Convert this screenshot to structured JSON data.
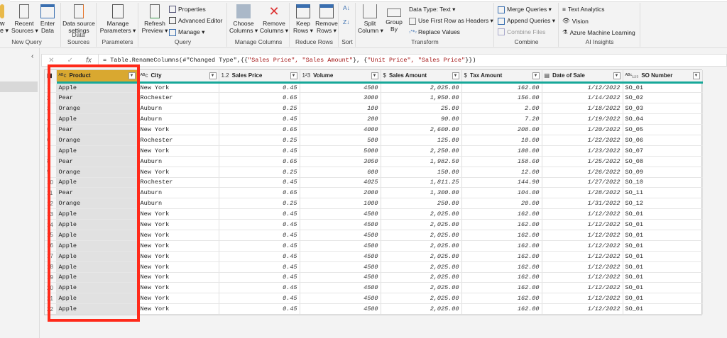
{
  "ribbon": {
    "groups": {
      "new_query": {
        "label": "New Query",
        "new_source": "w\ne ▾",
        "recent_sources": "Recent\nSources ▾",
        "enter_data": "Enter\nData"
      },
      "data_sources": {
        "label": "Data Sources",
        "settings": "Data source\nsettings"
      },
      "parameters": {
        "label": "Parameters",
        "manage": "Manage\nParameters ▾"
      },
      "query": {
        "label": "Query",
        "refresh": "Refresh\nPreview ▾",
        "properties": "Properties",
        "advanced_editor": "Advanced Editor",
        "manage": "Manage ▾"
      },
      "manage_columns": {
        "label": "Manage Columns",
        "choose": "Choose\nColumns ▾",
        "remove": "Remove\nColumns ▾"
      },
      "reduce_rows": {
        "label": "Reduce Rows",
        "keep": "Keep\nRows ▾",
        "remove": "Remove\nRows ▾"
      },
      "sort": {
        "label": "Sort"
      },
      "transform": {
        "label": "Transform",
        "split": "Split\nColumn ▾",
        "group_by": "Group\nBy",
        "data_type": "Data Type: Text ▾",
        "first_row": "Use First Row as Headers ▾",
        "replace": "Replace Values"
      },
      "combine": {
        "label": "Combine",
        "merge": "Merge Queries ▾",
        "append": "Append Queries ▾",
        "combine_files": "Combine Files"
      },
      "ai": {
        "label": "AI Insights",
        "text_analytics": "Text Analytics",
        "vision": "Vision",
        "azure_ml": "Azure Machine Learning"
      }
    }
  },
  "formula": {
    "fx": "fx",
    "prefix": "= Table.RenameColumns(#\"Changed Type\",{{",
    "s1": "\"Sales Price\", \"Sales Amount\"",
    "mid": "}, {",
    "s2": "\"Unit Price\", \"Sales Price\"",
    "suffix": "}})"
  },
  "table": {
    "columns": [
      {
        "name": "Product",
        "type_icon": "ABC",
        "selected": true
      },
      {
        "name": "City",
        "type_icon": "ABC"
      },
      {
        "name": "Sales Price",
        "type_icon": "1.2"
      },
      {
        "name": "Volume",
        "type_icon": "123"
      },
      {
        "name": "Sales Amount",
        "type_icon": "$"
      },
      {
        "name": "Tax Amount",
        "type_icon": "$"
      },
      {
        "name": "Date of Sale",
        "type_icon": "calendar"
      },
      {
        "name": "SO Number",
        "type_icon": "ABC123"
      }
    ],
    "rows": [
      [
        "Apple",
        "New York",
        "0.45",
        "4500",
        "2,025.00",
        "162.00",
        "1/12/2022",
        "SO_01"
      ],
      [
        "Pear",
        "Rochester",
        "0.65",
        "3000",
        "1,950.00",
        "156.00",
        "1/14/2022",
        "SO_02"
      ],
      [
        "Orange",
        "Auburn",
        "0.25",
        "100",
        "25.00",
        "2.00",
        "1/18/2022",
        "SO_03"
      ],
      [
        "Apple",
        "Auburn",
        "0.45",
        "200",
        "90.00",
        "7.20",
        "1/19/2022",
        "SO_04"
      ],
      [
        "Pear",
        "New York",
        "0.65",
        "4000",
        "2,600.00",
        "208.00",
        "1/20/2022",
        "SO_05"
      ],
      [
        "Orange",
        "Rochester",
        "0.25",
        "500",
        "125.00",
        "10.00",
        "1/22/2022",
        "SO_06"
      ],
      [
        "Apple",
        "New York",
        "0.45",
        "5000",
        "2,250.00",
        "180.00",
        "1/23/2022",
        "SO_07"
      ],
      [
        "Pear",
        "Auburn",
        "0.65",
        "3050",
        "1,982.50",
        "158.60",
        "1/25/2022",
        "SO_08"
      ],
      [
        "Orange",
        "New York",
        "0.25",
        "600",
        "150.00",
        "12.00",
        "1/26/2022",
        "SO_09"
      ],
      [
        "Apple",
        "Rochester",
        "0.45",
        "4025",
        "1,811.25",
        "144.90",
        "1/27/2022",
        "SO_10"
      ],
      [
        "Pear",
        "Auburn",
        "0.65",
        "2000",
        "1,300.00",
        "104.00",
        "1/28/2022",
        "SO_11"
      ],
      [
        "Orange",
        "Auburn",
        "0.25",
        "1000",
        "250.00",
        "20.00",
        "1/31/2022",
        "SO_12"
      ],
      [
        "Apple",
        "New York",
        "0.45",
        "4500",
        "2,025.00",
        "162.00",
        "1/12/2022",
        "SO_01"
      ],
      [
        "Apple",
        "New York",
        "0.45",
        "4500",
        "2,025.00",
        "162.00",
        "1/12/2022",
        "SO_01"
      ],
      [
        "Apple",
        "New York",
        "0.45",
        "4500",
        "2,025.00",
        "162.00",
        "1/12/2022",
        "SO_01"
      ],
      [
        "Apple",
        "New York",
        "0.45",
        "4500",
        "2,025.00",
        "162.00",
        "1/12/2022",
        "SO_01"
      ],
      [
        "Apple",
        "New York",
        "0.45",
        "4500",
        "2,025.00",
        "162.00",
        "1/12/2022",
        "SO_01"
      ],
      [
        "Apple",
        "New York",
        "0.45",
        "4500",
        "2,025.00",
        "162.00",
        "1/12/2022",
        "SO_01"
      ],
      [
        "Apple",
        "New York",
        "0.45",
        "4500",
        "2,025.00",
        "162.00",
        "1/12/2022",
        "SO_01"
      ],
      [
        "Apple",
        "New York",
        "0.45",
        "4500",
        "2,025.00",
        "162.00",
        "1/12/2022",
        "SO_01"
      ],
      [
        "Apple",
        "New York",
        "0.45",
        "4500",
        "2,025.00",
        "162.00",
        "1/12/2022",
        "SO_01"
      ],
      [
        "Apple",
        "New York",
        "0.45",
        "4500",
        "2,025.00",
        "162.00",
        "1/12/2022",
        "SO_01"
      ]
    ]
  },
  "colors": {
    "selected_header": "#d9a830",
    "highlight_box": "#ff2a1a",
    "quality_bar": "#17a899"
  }
}
